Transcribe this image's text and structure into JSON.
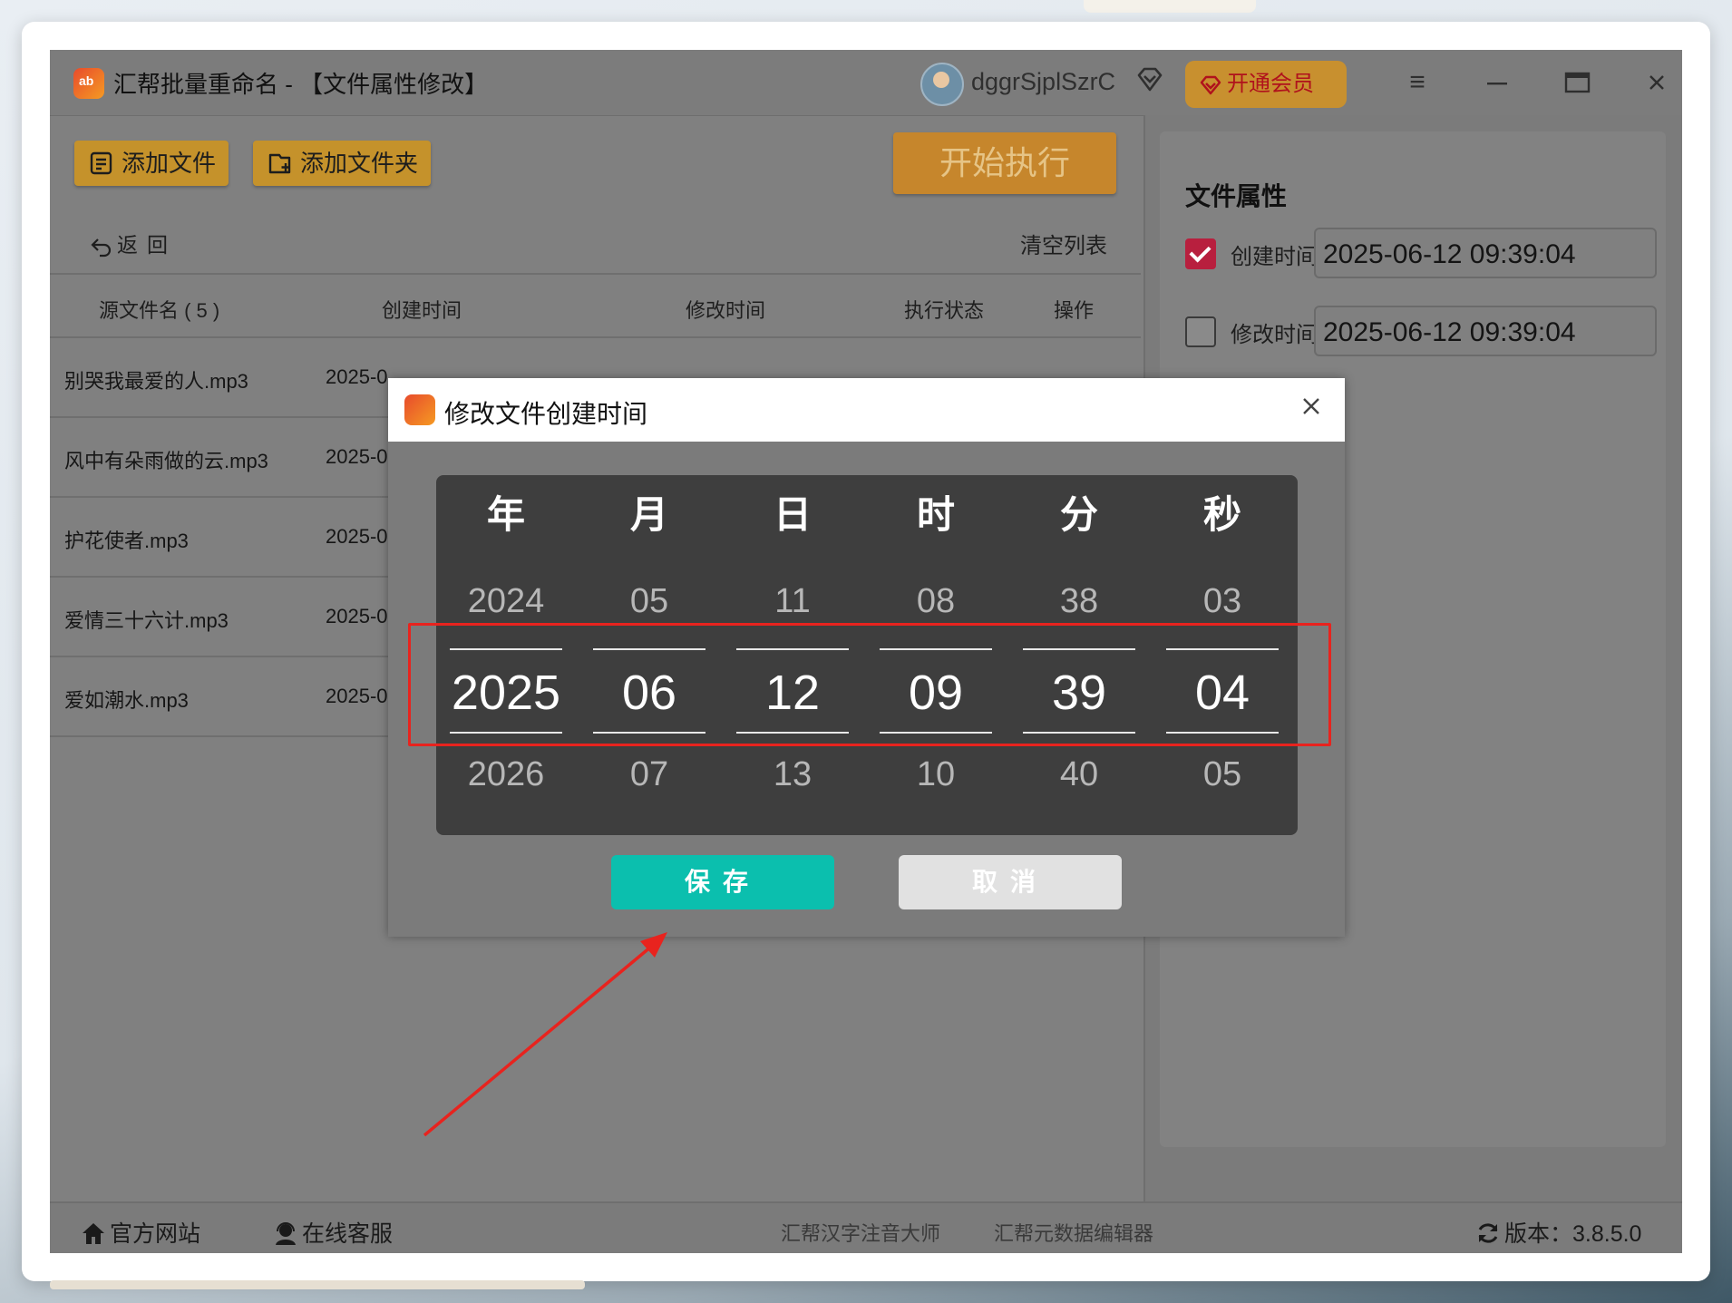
{
  "app": {
    "title": "汇帮批量重命名 - 【文件属性修改】",
    "username": "dggrSjplSzrC",
    "vip_label": "开通会员"
  },
  "toolbar": {
    "add_file": "添加文件",
    "add_folder": "添加文件夹",
    "start": "开始执行",
    "back": "返回",
    "clear": "清空列表"
  },
  "table": {
    "headers": [
      "源文件名 ( 5 )",
      "创建时间",
      "修改时间",
      "执行状态",
      "操作"
    ],
    "rows": [
      {
        "name": "别哭我最爱的人.mp3",
        "ctime": "2025-0",
        "mtime": "",
        "status": "",
        "op": ""
      },
      {
        "name": "风中有朵雨做的云.mp3",
        "ctime": "2025-0",
        "mtime": "",
        "status": "",
        "op": ""
      },
      {
        "name": "护花使者.mp3",
        "ctime": "2025-0",
        "mtime": "",
        "status": "",
        "op": ""
      },
      {
        "name": "爱情三十六计.mp3",
        "ctime": "2025-0",
        "mtime": "",
        "status": "",
        "op": ""
      },
      {
        "name": "爱如潮水.mp3",
        "ctime": "2025-0",
        "mtime": "",
        "status": "",
        "op": ""
      }
    ]
  },
  "properties": {
    "title": "文件属性",
    "created_label": "创建时间",
    "created_value": "2025-06-12 09:39:04",
    "created_checked": true,
    "modified_label": "修改时间",
    "modified_value": "2025-06-12 09:39:04",
    "modified_checked": false
  },
  "dialog": {
    "title": "修改文件创建时间",
    "columns": [
      {
        "header": "年",
        "prev": "2024",
        "current": "2025",
        "next": "2026"
      },
      {
        "header": "月",
        "prev": "05",
        "current": "06",
        "next": "07"
      },
      {
        "header": "日",
        "prev": "11",
        "current": "12",
        "next": "13"
      },
      {
        "header": "时",
        "prev": "08",
        "current": "09",
        "next": "10"
      },
      {
        "header": "分",
        "prev": "38",
        "current": "39",
        "next": "40"
      },
      {
        "header": "秒",
        "prev": "03",
        "current": "04",
        "next": "05"
      }
    ],
    "save": "保存",
    "cancel": "取消"
  },
  "statusbar": {
    "website": "官方网站",
    "support": "在线客服",
    "link1": "汇帮汉字注音大师",
    "link2": "汇帮元数据编辑器",
    "version": "版本：3.8.5.0"
  },
  "colors": {
    "accent_yellow": "#c5922b",
    "save_teal": "#0bbfae",
    "highlight_red": "#e8231e",
    "checkbox_red": "#b81f3e"
  }
}
